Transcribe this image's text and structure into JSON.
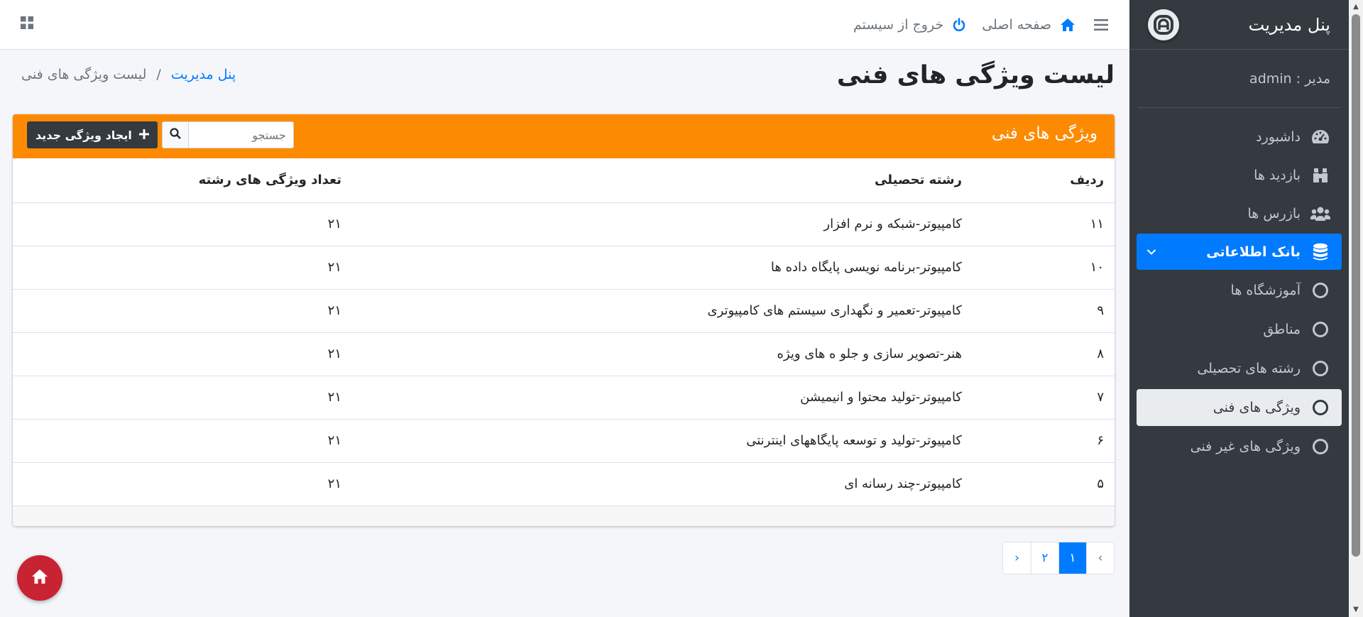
{
  "colors": {
    "accent": "#007bff",
    "header_orange": "#fd8a03",
    "sidebar_bg": "#343a40",
    "fab_red": "#c82333"
  },
  "sidebar": {
    "brand": "پنل مدیریت",
    "user": "مدیر : admin",
    "items": [
      {
        "label": "داشبورد",
        "icon": "dashboard-icon"
      },
      {
        "label": "بازدید ها",
        "icon": "binoculars-icon"
      },
      {
        "label": "بازرس ها",
        "icon": "users-icon"
      },
      {
        "label": "بانک اطلاعاتی",
        "icon": "database-icon",
        "active": true
      },
      {
        "label": "آموزشگاه ها",
        "icon": "circle-icon"
      },
      {
        "label": "مناطق",
        "icon": "circle-icon"
      },
      {
        "label": "رشته های تحصیلی",
        "icon": "circle-icon"
      },
      {
        "label": "ویژگی های فنی",
        "icon": "circle-icon",
        "selected": true
      },
      {
        "label": "ویژگی های غیر فنی",
        "icon": "circle-icon"
      }
    ]
  },
  "topbar": {
    "home_label": "صفحه اصلی",
    "logout_label": "خروج از سیستم"
  },
  "page": {
    "title": "لیست ویژگی های فنی",
    "breadcrumb_link": "پنل مدیریت",
    "breadcrumb_sep": "/",
    "breadcrumb_current": "لیست ویژگی های فنی"
  },
  "card": {
    "title": "ویژگی های فنی",
    "search_placeholder": "جستجو",
    "new_button": "ایجاد ویژگی جدید"
  },
  "table": {
    "headers": [
      "ردیف",
      "رشته تحصیلی",
      "تعداد ویژگی های رشته"
    ],
    "rows": [
      [
        "۱۱",
        "کامپیوتر-شبکه و نرم افزار",
        "۲۱"
      ],
      [
        "۱۰",
        "کامپیوتر-برنامه نویسی پایگاه داده ها",
        "۲۱"
      ],
      [
        "۹",
        "کامپیوتر-تعمیر و نگهداری سیستم های کامپیوتری",
        "۲۱"
      ],
      [
        "۸",
        "هنر-تصویر سازی و جلو ه های ویژه",
        "۲۱"
      ],
      [
        "۷",
        "کامپیوتر-تولید محتوا و انیمیشن",
        "۲۱"
      ],
      [
        "۶",
        "کامپیوتر-تولید و توسعه پایگاههای اینترنتی",
        "۲۱"
      ],
      [
        "۵",
        "کامپیوتر-چند رسانه ای",
        "۲۱"
      ]
    ]
  },
  "pagination": {
    "prev": "‹",
    "pages": [
      "۱",
      "۲"
    ],
    "next": "›",
    "current": "۱"
  }
}
